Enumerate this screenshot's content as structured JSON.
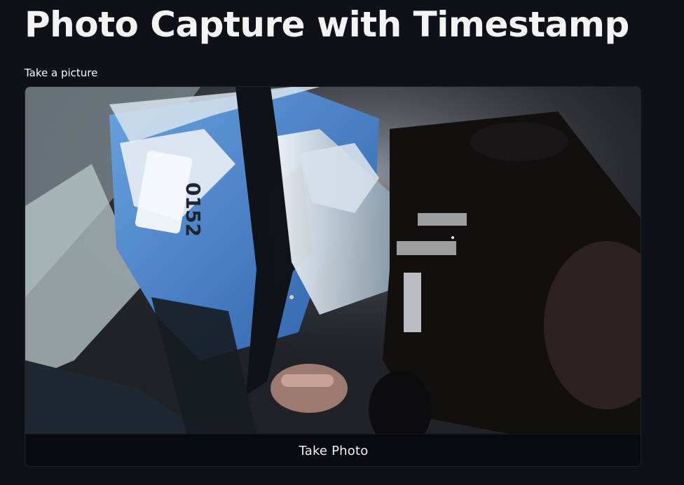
{
  "page": {
    "title": "Photo Capture with Timestamp"
  },
  "camera_input": {
    "label": "Take a picture",
    "button_label": "Take Photo"
  },
  "preview": {
    "description": "Live camera preview",
    "tags": [
      "photo-preview",
      "camera-feed"
    ]
  }
}
